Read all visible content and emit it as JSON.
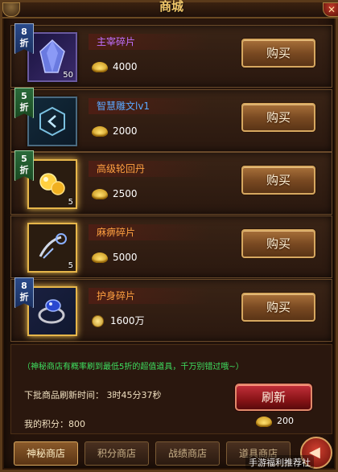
{
  "window": {
    "title": "商城"
  },
  "items": [
    {
      "discount": "8折",
      "name": "主宰碎片",
      "count": "50",
      "price": "4000",
      "currency": "ingot",
      "buy_label": "购买"
    },
    {
      "discount": "5折",
      "name": "智慧雕文lv1",
      "count": "",
      "price": "2000",
      "currency": "ingot",
      "buy_label": "购买"
    },
    {
      "discount": "5折",
      "name": "高级轮回丹",
      "count": "5",
      "price": "2500",
      "currency": "ingot",
      "buy_label": "购买"
    },
    {
      "discount": "",
      "name": "麻痹碎片",
      "count": "5",
      "price": "5000",
      "currency": "ingot",
      "buy_label": "购买"
    },
    {
      "discount": "8折",
      "name": "护身碎片",
      "count": "",
      "price": "1600万",
      "currency": "coin",
      "buy_label": "购买"
    }
  ],
  "footer": {
    "tip": "（神秘商店有概率刷到最低5折的超值道具，千万别错过哦~）",
    "refresh_time_label": "下批商品刷新时间：  3时45分37秒",
    "points_label": "我的积分：800",
    "refresh_button": "刷新",
    "refresh_cost": "200"
  },
  "tabs": [
    "神秘商店",
    "积分商店",
    "战绩商店",
    "道具商店"
  ],
  "watermark": "手游福利推荐社",
  "colors": {
    "accent_gold": "#d6a860",
    "tip_green": "#3ee060",
    "refresh_red": "#c2303a"
  },
  "icons": [
    "diamond-shard-icon",
    "rune-glyph-icon",
    "golden-pill-icon",
    "chain-shard-icon",
    "blue-ring-icon",
    "ingot-icon",
    "coin-icon",
    "back-arrow-icon"
  ]
}
